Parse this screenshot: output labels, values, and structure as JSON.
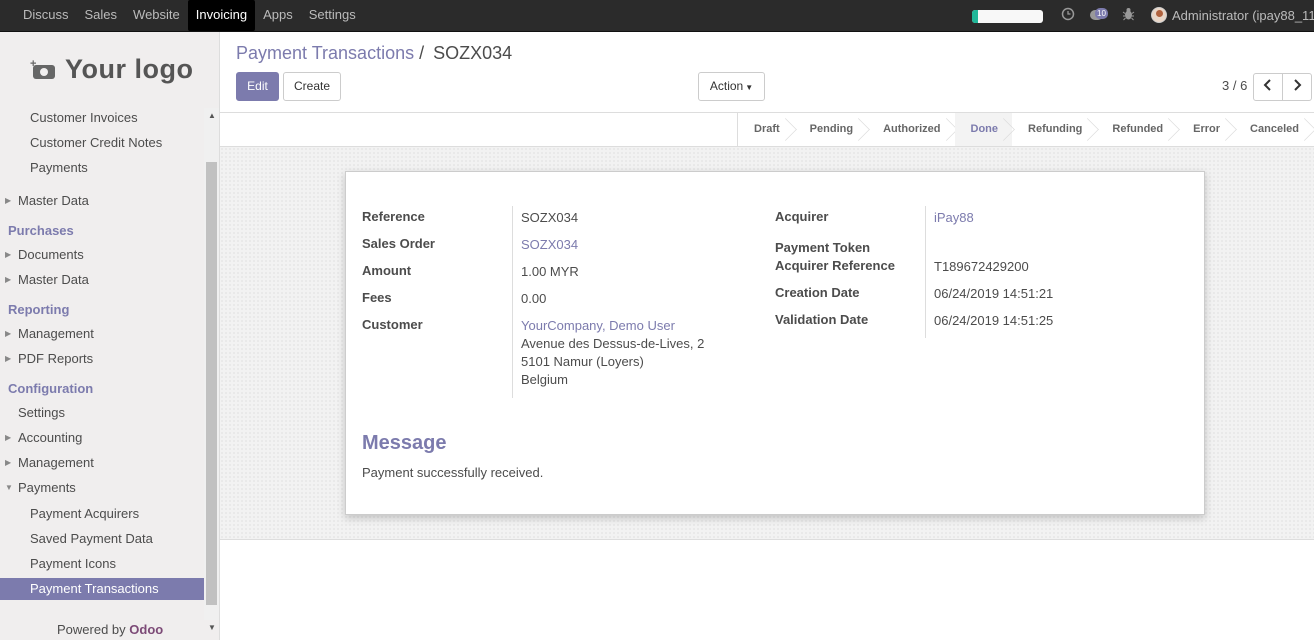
{
  "topbar": {
    "apps": [
      "Discuss",
      "Sales",
      "Website",
      "Invoicing",
      "Apps",
      "Settings"
    ],
    "active_app": "Invoicing",
    "progress_fraction": 0.08,
    "chat_count": "10",
    "user_name": "Administrator (ipay88_11"
  },
  "sidebar": {
    "logo_text": "Your logo",
    "items": [
      {
        "label": "Customer Invoices",
        "kind": "lvl2"
      },
      {
        "label": "Customer Credit Notes",
        "kind": "lvl2"
      },
      {
        "label": "Payments",
        "kind": "lvl2"
      },
      {
        "label": "Master Data",
        "kind": "lvl1-collapsed"
      },
      {
        "label": "Purchases",
        "kind": "section"
      },
      {
        "label": "Documents",
        "kind": "lvl1-collapsed"
      },
      {
        "label": "Master Data",
        "kind": "lvl1-collapsed"
      },
      {
        "label": "Reporting",
        "kind": "section"
      },
      {
        "label": "Management",
        "kind": "lvl1-collapsed"
      },
      {
        "label": "PDF Reports",
        "kind": "lvl1-collapsed"
      },
      {
        "label": "Configuration",
        "kind": "section"
      },
      {
        "label": "Settings",
        "kind": "lvl1"
      },
      {
        "label": "Accounting",
        "kind": "lvl1-collapsed"
      },
      {
        "label": "Management",
        "kind": "lvl1-collapsed"
      },
      {
        "label": "Payments",
        "kind": "lvl1-expanded"
      },
      {
        "label": "Payment Acquirers",
        "kind": "lvl2"
      },
      {
        "label": "Saved Payment Data",
        "kind": "lvl2"
      },
      {
        "label": "Payment Icons",
        "kind": "lvl2"
      },
      {
        "label": "Payment Transactions",
        "kind": "lvl2-active"
      }
    ],
    "powered_by": "Powered by",
    "powered_brand": "Odoo"
  },
  "breadcrumb": {
    "parent": "Payment Transactions",
    "separator": "/",
    "current": "SOZX034"
  },
  "buttons": {
    "edit": "Edit",
    "create": "Create",
    "action": "Action"
  },
  "pager": {
    "value": "3 / 6"
  },
  "status_steps": [
    "Draft",
    "Pending",
    "Authorized",
    "Done",
    "Refunding",
    "Refunded",
    "Error",
    "Canceled"
  ],
  "status_current": "Done",
  "form": {
    "left": {
      "reference_label": "Reference",
      "reference": "SOZX034",
      "sales_order_label": "Sales Order",
      "sales_order": "SOZX034",
      "amount_label": "Amount",
      "amount": "1.00 MYR",
      "fees_label": "Fees",
      "fees": "0.00",
      "customer_label": "Customer",
      "customer_name": "YourCompany, Demo User",
      "customer_street": "Avenue des Dessus-de-Lives, 2",
      "customer_city": "5101 Namur (Loyers)",
      "customer_country": "Belgium"
    },
    "right": {
      "acquirer_label": "Acquirer",
      "acquirer": "iPay88",
      "payment_token_label": "Payment Token",
      "acquirer_reference_label": "Acquirer Reference",
      "acquirer_reference": "T189672429200",
      "creation_date_label": "Creation Date",
      "creation_date": "06/24/2019 14:51:21",
      "validation_date_label": "Validation Date",
      "validation_date": "06/24/2019 14:51:25"
    },
    "message_title": "Message",
    "message_body": "Payment successfully received."
  },
  "colors": {
    "accent": "#7c7bad",
    "topbar_bg": "#2b2b2b",
    "sidebar_bg": "#f0eeee",
    "progress": "#21b799"
  }
}
